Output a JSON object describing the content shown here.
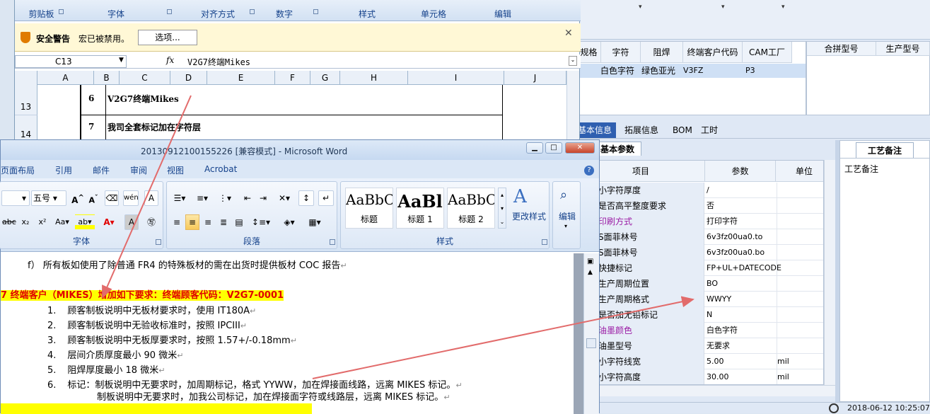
{
  "right_app": {
    "top_carets": [
      "▾",
      "▾",
      "▾"
    ],
    "grid_headers": [
      "规格",
      "字符",
      "阻焊",
      "终端客户代码",
      "CAM工厂"
    ],
    "grid_row": [
      "白色字符",
      "绿色亚光",
      "V3FZ",
      "P3"
    ],
    "grid_right_headers": [
      "合拼型号",
      "生产型号"
    ],
    "tabs": [
      "基本信息",
      "拓展信息",
      "BOM",
      "工时"
    ],
    "param_tab": "基本参数",
    "param_headers": {
      "item": "项目",
      "param": "参数",
      "unit": "单位"
    },
    "params": [
      {
        "k": "小字符厚度",
        "v": "/",
        "u": "",
        "purple": false
      },
      {
        "k": "是否高平整度要求",
        "v": "否",
        "u": "",
        "purple": false
      },
      {
        "k": "印刷方式",
        "v": "打印字符",
        "u": "",
        "purple": true
      },
      {
        "k": "S面菲林号",
        "v": "6v3fz00ua0.to",
        "u": "",
        "purple": false
      },
      {
        "k": "S面菲林号",
        "v": "6v3fz00ua0.bo",
        "u": "",
        "purple": false
      },
      {
        "k": "快捷标记",
        "v": "FP+UL+DATECODE",
        "u": "",
        "purple": false
      },
      {
        "k": "生产周期位置",
        "v": "BO",
        "u": "",
        "purple": false
      },
      {
        "k": "生产周期格式",
        "v": "WWYY",
        "u": "",
        "purple": false
      },
      {
        "k": "是否加无铅标记",
        "v": "N",
        "u": "",
        "purple": false
      },
      {
        "k": "油墨颜色",
        "v": "白色字符",
        "u": "",
        "purple": true
      },
      {
        "k": "油墨型号",
        "v": "无要求",
        "u": "",
        "purple": false
      },
      {
        "k": "小字符线宽",
        "v": "5.00",
        "u": "mil",
        "purple": false
      },
      {
        "k": "小字符高度",
        "v": "30.00",
        "u": "mil",
        "purple": false
      }
    ],
    "craft_tab": "工艺备注",
    "craft_label": "工艺备注",
    "status_time": "2018-06-12 10:25:07"
  },
  "excel": {
    "groups": [
      "剪贴板",
      "字体",
      "对齐方式",
      "数字",
      "样式",
      "单元格",
      "编辑"
    ],
    "security_title": "安全警告",
    "security_msg": "宏已被禁用。",
    "security_button": "选项...",
    "namebox": "C13",
    "fx": "fx",
    "formula": "V2G7终端Mikes",
    "columns": [
      "A",
      "B",
      "C",
      "D",
      "E",
      "F",
      "G",
      "H",
      "I",
      "J"
    ],
    "rows": [
      {
        "num": "13",
        "b": "6",
        "c": "V2G7终端Mikes"
      },
      {
        "num": "14",
        "b": "7",
        "c": "我司全套标记加在字符层"
      }
    ]
  },
  "word": {
    "title": "20130912100155226 [兼容模式] - Microsoft Word",
    "tabs": [
      "页面布局",
      "引用",
      "邮件",
      "审阅",
      "视图",
      "Acrobat"
    ],
    "font_size": "五号",
    "groups": {
      "font": "字体",
      "paragraph": "段落",
      "styles": "样式"
    },
    "styles": [
      {
        "preview": "AaBbC",
        "name": "标题"
      },
      {
        "preview": "AaBl",
        "name": "标题 1"
      },
      {
        "preview": "AaBbC",
        "name": "标题 2"
      }
    ],
    "change_styles": "更改样式",
    "edit": "编辑",
    "lines": {
      "f": "f） 所有板如使用了除普通 FR4 的特殊板材的需在出货时提供板材 COC 报告",
      "heading": "7 终端客户（MIKES）增加如下要求：终端顾客代码：V2G7-0001",
      "items": [
        {
          "n": "1.",
          "t": "顾客制板说明中无板材要求时，使用 IT180A"
        },
        {
          "n": "2.",
          "t": "顾客制板说明中无验收标准时，按照 IPCIII"
        },
        {
          "n": "3.",
          "t": "顾客制板说明中无板厚要求时，按照 1.57+/-0.18mm"
        },
        {
          "n": "4.",
          "t": "层间介质厚度最小 90 微米"
        },
        {
          "n": "5.",
          "t": "阻焊厚度最小 18 微米"
        },
        {
          "n": "6.",
          "t": "标记：制板说明中无要求时，加周期标记，格式 YYWW，加在焊接面线路，远离 MIKES 标记。"
        }
      ],
      "item6b": "制板说明中无要求时，加我公司标记，加在焊接面字符或线路层，远离 MIKES 标记。",
      "para_mark": "↵"
    }
  },
  "colors": {
    "accent": "#2f5fb0",
    "highlight": "#ffff00",
    "highlight_text": "#e00000",
    "arrow": "#e26b6b",
    "purple": "#9b1ca5"
  }
}
